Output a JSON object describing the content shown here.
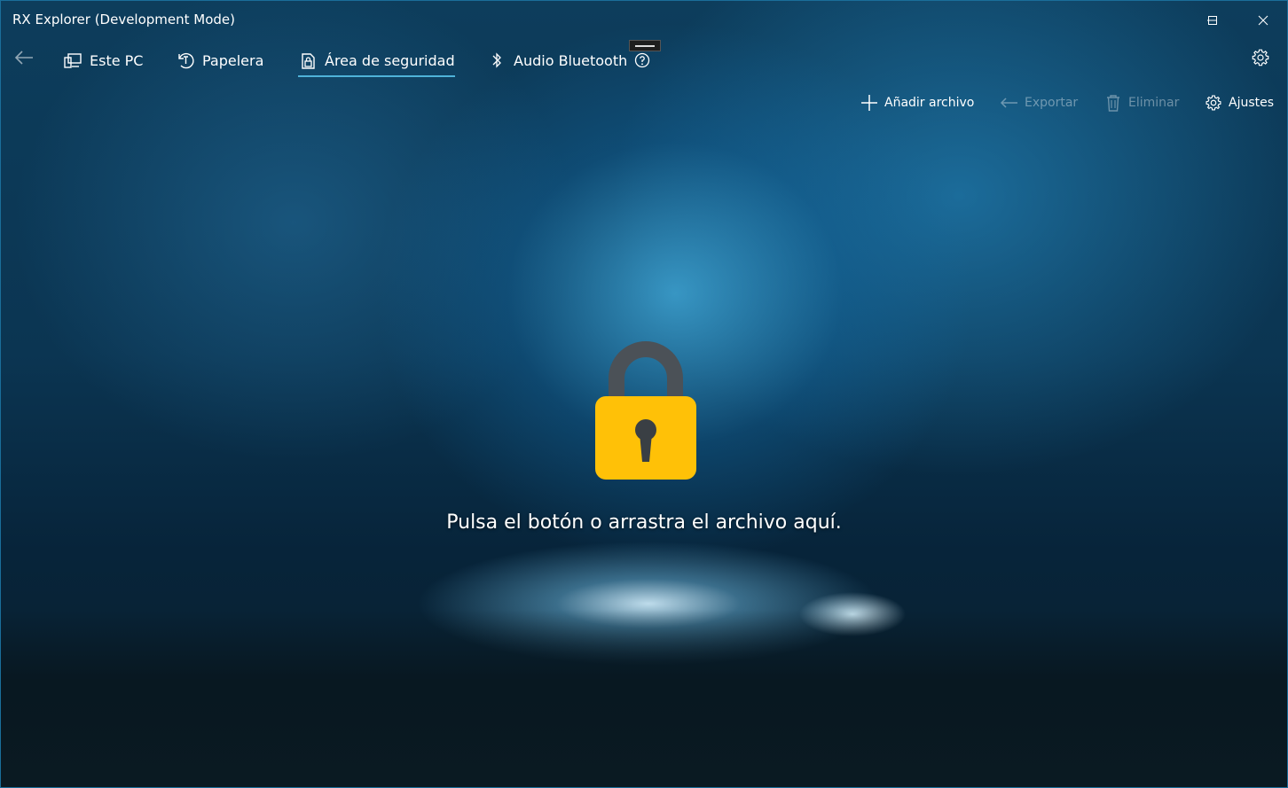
{
  "window": {
    "title": "RX Explorer (Development Mode)",
    "controls": [
      "minimize-icon",
      "maximize-icon",
      "close-icon"
    ]
  },
  "nav": {
    "back_icon": "arrow-left-icon",
    "tabs": [
      {
        "label": "Este PC",
        "icon": "this-pc-icon",
        "active": false
      },
      {
        "label": "Papelera",
        "icon": "recycle-bin-icon",
        "active": false
      },
      {
        "label": "Área de seguridad",
        "icon": "secure-area-icon",
        "active": true
      },
      {
        "label": "Audio Bluetooth",
        "icon": "bluetooth-icon",
        "active": false
      }
    ],
    "help_icon": "question-circle-icon",
    "settings_icon": "gear-icon"
  },
  "commands": {
    "add_file": "Añadir archivo",
    "export": "Exportar",
    "delete": "Eliminar",
    "settings": "Ajustes"
  },
  "main": {
    "lock_icon": "padlock-icon",
    "hint": "Pulsa el botón o arrastra el archivo aquí."
  },
  "colors": {
    "accent": "#4fb3d9",
    "lock_body": "#ffc107",
    "lock_shackle": "#4b5157"
  }
}
